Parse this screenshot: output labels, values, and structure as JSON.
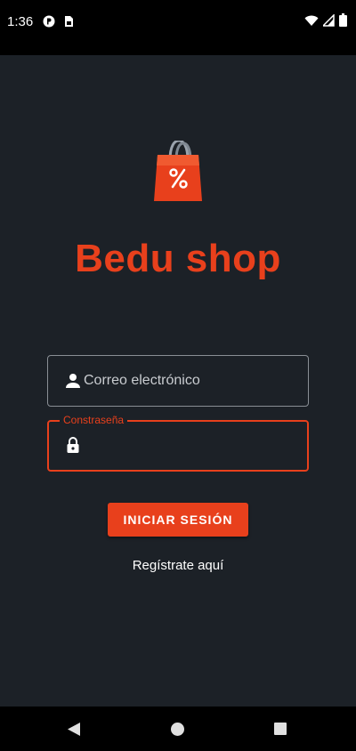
{
  "status_bar": {
    "time": "1:36",
    "icons_left": [
      "p-circle-icon",
      "sim-card-icon"
    ],
    "icons_right": [
      "wifi-icon",
      "signal-icon",
      "battery-icon"
    ]
  },
  "app": {
    "title": "Bedu shop",
    "logo_icon": "shopping-bag-percent-icon",
    "email_field": {
      "icon": "person-icon",
      "placeholder": "Correo electrónico",
      "value": ""
    },
    "password_field": {
      "icon": "lock-icon",
      "label": "Constraseña",
      "value": ""
    },
    "login_button": "INICIAR SESIÓN",
    "register_link": "Regístrate aquí"
  },
  "nav_bar": {
    "icons": [
      "back-icon",
      "home-icon",
      "recents-icon"
    ]
  },
  "colors": {
    "accent": "#e8401c",
    "background": "#1c2127",
    "system_bars": "#000000"
  }
}
